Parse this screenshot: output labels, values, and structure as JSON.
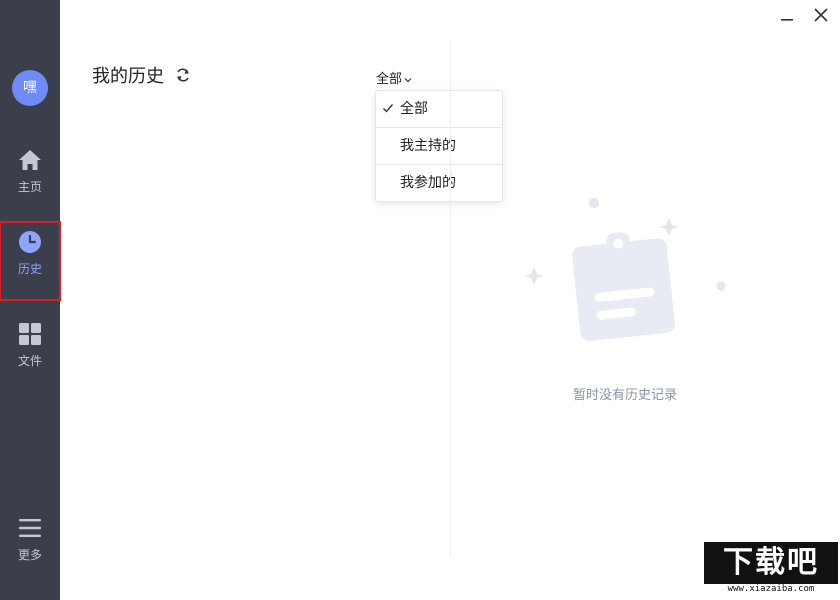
{
  "sidebar": {
    "avatar_text": "嘿",
    "items": [
      {
        "label": "主页",
        "icon": "home-icon"
      },
      {
        "label": "历史",
        "icon": "clock-icon",
        "active": true
      },
      {
        "label": "文件",
        "icon": "grid-icon"
      },
      {
        "label": "更多",
        "icon": "menu-icon"
      }
    ]
  },
  "header": {
    "title": "我的历史",
    "filter": {
      "selected": "全部",
      "options": [
        "全部",
        "我主持的",
        "我参加的"
      ]
    }
  },
  "empty_state": {
    "text": "暂时没有历史记录"
  },
  "watermark": {
    "title": "下载吧",
    "url": "www.xiazaiba.com"
  },
  "colors": {
    "sidebar_bg": "#3a3f4b",
    "accent": "#6d8cf5",
    "active_outline": "#d7202a",
    "empty_text": "#8a93a3"
  }
}
